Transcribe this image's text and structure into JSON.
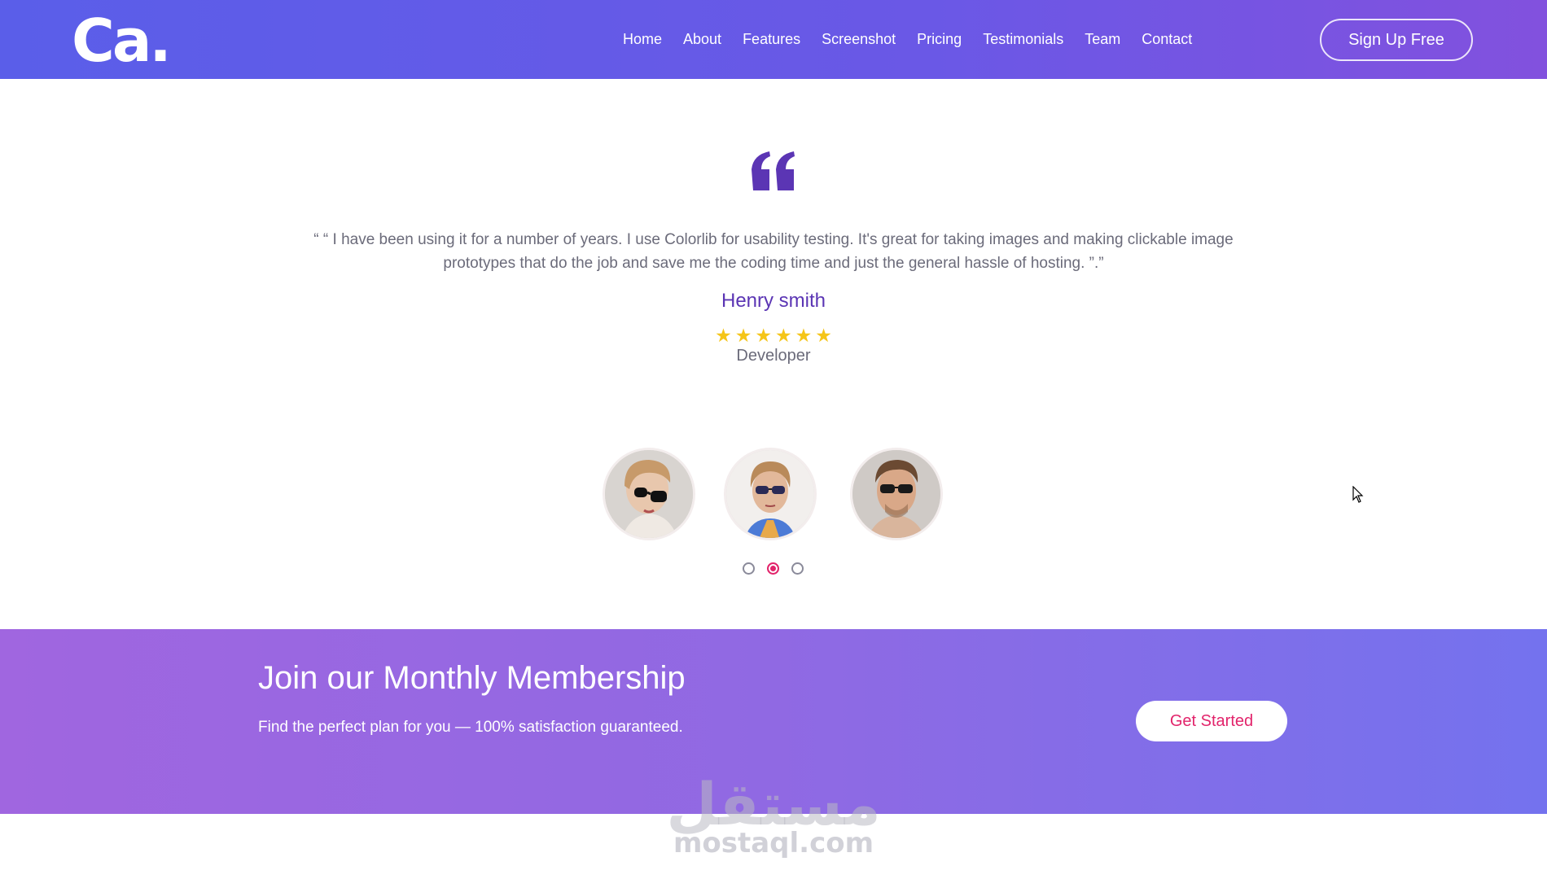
{
  "header": {
    "brand": "Ca.",
    "nav": [
      "Home",
      "About",
      "Features",
      "Screenshot",
      "Pricing",
      "Testimonials",
      "Team",
      "Contact"
    ],
    "signup_label": "Sign Up Free"
  },
  "testimonial": {
    "quote": "“ “ I have been using it for a number of years. I use Colorlib for usability testing. It's great for taking images and making clickable image prototypes that do the job and save me the coding time and just the general hassle of hosting. ”.”",
    "name": "Henry smith",
    "rating": 6,
    "role": "Developer",
    "avatars": [
      "avatar-woman-black-sunglasses",
      "avatar-woman-blue-sunglasses",
      "avatar-man-sunglasses"
    ],
    "active_slide": 2,
    "slide_count": 3
  },
  "banner": {
    "title": "Join our Monthly Membership",
    "subtitle": "Find the perfect plan for you — 100% satisfaction guaranteed.",
    "cta_label": "Get Started"
  },
  "watermark": {
    "arabic": "مستقل",
    "latin": "mostaql.com"
  },
  "colors": {
    "header_gradient_start": "#5a5ee9",
    "header_gradient_end": "#8251de",
    "accent_purple": "#5b35b4",
    "accent_pink": "#e2246b",
    "star": "#f5c518",
    "banner_gradient_start": "#a066e0",
    "banner_gradient_end": "#7472ee"
  }
}
